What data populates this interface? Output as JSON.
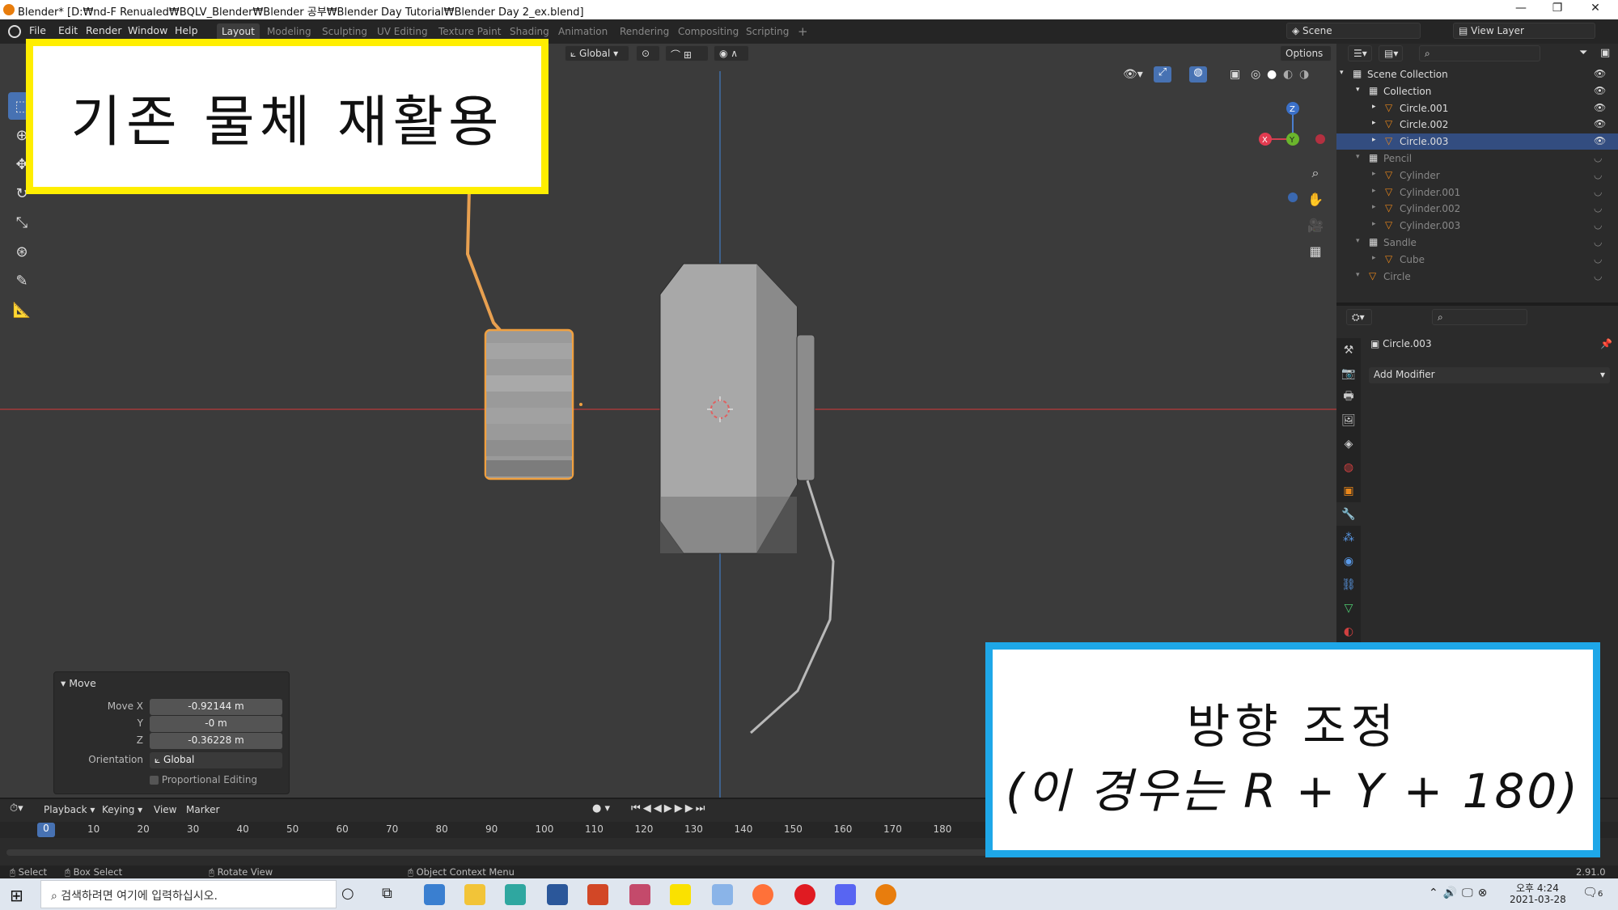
{
  "window": {
    "title": "Blender* [D:₩nd-F Renualed₩BQLV_Blender₩Blender 공부₩Blender Day Tutorial₩Blender Day 2_ex.blend]",
    "controls": [
      "—",
      "❐",
      "✕"
    ]
  },
  "menubar": {
    "menus": [
      "File",
      "Edit",
      "Render",
      "Window",
      "Help"
    ],
    "workspaces": [
      "Layout",
      "Modeling",
      "Sculpting",
      "UV Editing",
      "Texture Paint",
      "Shading",
      "Animation",
      "Rendering",
      "Compositing",
      "Scripting"
    ],
    "add_workspace": "+",
    "scene": "Scene",
    "view_layer": "View Layer"
  },
  "viewport_header": {
    "orientation": "Global",
    "options": "Options"
  },
  "gizmo": {
    "x": "X",
    "y": "Y",
    "z": "Z"
  },
  "move_panel": {
    "title": "Move",
    "move_x_label": "Move X",
    "move_x": "-0.92144 m",
    "y_label": "Y",
    "y": "-0 m",
    "z_label": "Z",
    "z": "-0.36228 m",
    "orientation_label": "Orientation",
    "orientation": "Global",
    "proportional": "Proportional Editing"
  },
  "outliner": {
    "rows": [
      {
        "label": "Scene Collection",
        "indent": 0,
        "dim": false,
        "sel": false
      },
      {
        "label": "Collection",
        "indent": 1,
        "dim": false,
        "sel": false
      },
      {
        "label": "Circle.001",
        "indent": 2,
        "dim": false,
        "sel": false
      },
      {
        "label": "Circle.002",
        "indent": 2,
        "dim": false,
        "sel": false
      },
      {
        "label": "Circle.003",
        "indent": 2,
        "dim": false,
        "sel": true
      },
      {
        "label": "Pencil",
        "indent": 1,
        "dim": true,
        "sel": false
      },
      {
        "label": "Cylinder",
        "indent": 2,
        "dim": true,
        "sel": false
      },
      {
        "label": "Cylinder.001",
        "indent": 2,
        "dim": true,
        "sel": false
      },
      {
        "label": "Cylinder.002",
        "indent": 2,
        "dim": true,
        "sel": false
      },
      {
        "label": "Cylinder.003",
        "indent": 2,
        "dim": true,
        "sel": false
      },
      {
        "label": "Sandle",
        "indent": 1,
        "dim": true,
        "sel": false
      },
      {
        "label": "Cube",
        "indent": 2,
        "dim": true,
        "sel": false
      },
      {
        "label": "Circle",
        "indent": 1,
        "dim": true,
        "sel": false
      }
    ]
  },
  "properties": {
    "object": "Circle.003",
    "add_modifier": "Add Modifier"
  },
  "timeline": {
    "menus": [
      "Playback",
      "Keying",
      "View",
      "Marker"
    ],
    "current_frame": "0",
    "ticks": [
      "10",
      "20",
      "30",
      "40",
      "50",
      "60",
      "70",
      "80",
      "90",
      "100",
      "110",
      "120",
      "130",
      "140",
      "150",
      "160",
      "170",
      "180"
    ]
  },
  "statusbar": {
    "select": "Select",
    "box_select": "Box Select",
    "rotate": "Rotate View",
    "context": "Object Context Menu",
    "version": "2.91.0"
  },
  "taskbar": {
    "search": "검색하려면 여기에 입력하십시오.",
    "time": "오후 4:24",
    "date": "2021-03-28",
    "notifications": "6"
  },
  "callouts": {
    "top_left": "기존 물체 재활용",
    "bottom_right_line1": "방향 조정",
    "bottom_right_line2": "(이 경우는 R + Y + 180)"
  },
  "colors": {
    "accent": "#4772b3",
    "selection_outline": "#f0a040",
    "yellow_border": "#ffee00",
    "blue_border": "#1ea7e8"
  }
}
